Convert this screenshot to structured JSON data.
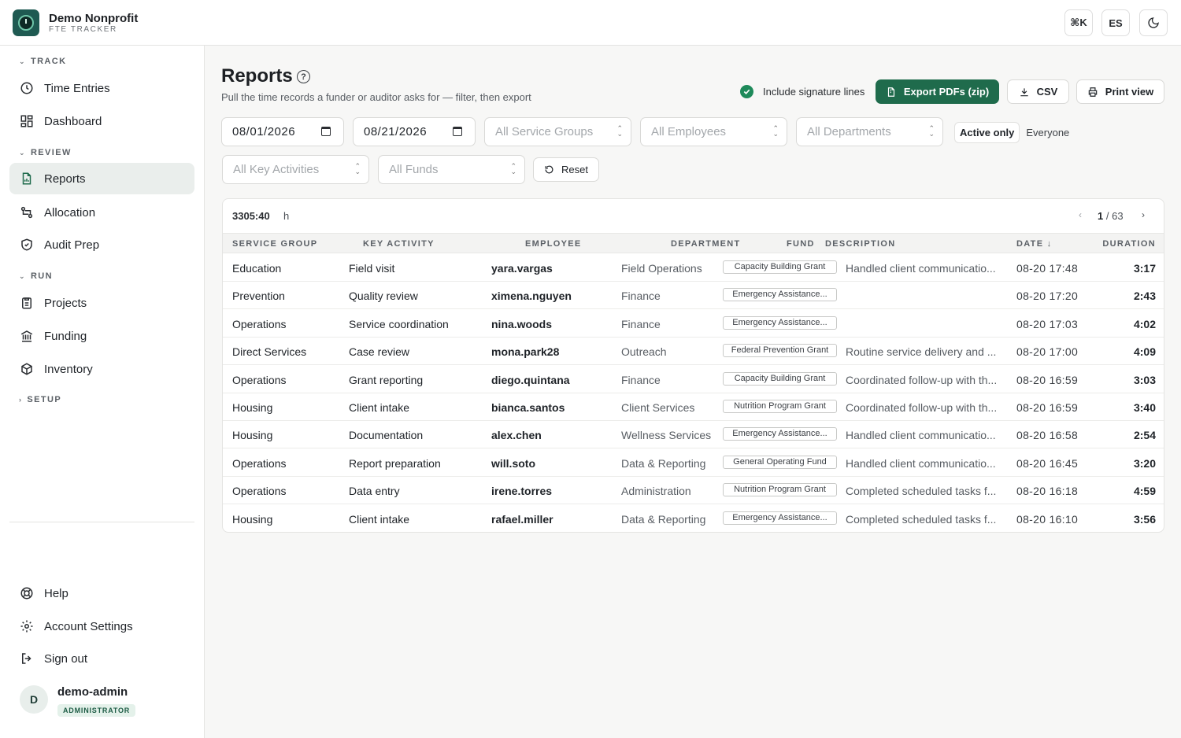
{
  "app": {
    "org_name": "Demo Nonprofit",
    "org_subtitle": "FTE TRACKER",
    "cmdk_label": "⌘K",
    "lang_label": "ES"
  },
  "sidebar": {
    "sections": [
      {
        "title": "TRACK",
        "items": [
          "Time Entries",
          "Dashboard"
        ]
      },
      {
        "title": "REVIEW",
        "items": [
          "Reports",
          "Allocation",
          "Audit Prep"
        ]
      },
      {
        "title": "RUN",
        "items": [
          "Projects",
          "Funding",
          "Inventory"
        ]
      },
      {
        "title": "SETUP",
        "items": []
      }
    ],
    "footer_items": [
      "Help",
      "Account Settings",
      "Sign out"
    ],
    "user": {
      "initial": "D",
      "name": "demo-admin",
      "role": "ADMINISTRATOR"
    }
  },
  "page": {
    "title": "Reports",
    "subtitle": "Pull the time records a funder or auditor asks for — filter, then export",
    "signature_label": "Include signature lines",
    "export_pdfs_label": "Export PDFs (zip)",
    "csv_label": "CSV",
    "print_label": "Print view"
  },
  "filters": {
    "date_from": "08/01/2026",
    "date_to": "08/21/2026",
    "service_groups": "All Service Groups",
    "employees": "All Employees",
    "departments": "All Departments",
    "scope_active": "Active only",
    "scope_everyone": "Everyone",
    "key_activities": "All Key Activities",
    "funds": "All Funds",
    "reset_label": "Reset"
  },
  "table": {
    "total": "3305:40",
    "total_unit": "h",
    "page_current": "1",
    "page_total": "/ 63",
    "columns": [
      "SERVICE GROUP",
      "KEY ACTIVITY",
      "EMPLOYEE",
      "DEPARTMENT",
      "FUND",
      "DESCRIPTION",
      "DATE ↓",
      "DURATION"
    ],
    "rows": [
      [
        "Education",
        "Field visit",
        "yara.vargas",
        "Field Operations",
        "Capacity Building Grant",
        "Handled client communicatio...",
        "08-20 17:48",
        "3:17"
      ],
      [
        "Prevention",
        "Quality review",
        "ximena.nguyen",
        "Finance",
        "Emergency Assistance...",
        "",
        "08-20 17:20",
        "2:43"
      ],
      [
        "Operations",
        "Service coordination",
        "nina.woods",
        "Finance",
        "Emergency Assistance...",
        "",
        "08-20 17:03",
        "4:02"
      ],
      [
        "Direct Services",
        "Case review",
        "mona.park28",
        "Outreach",
        "Federal Prevention Grant",
        "Routine service delivery and ...",
        "08-20 17:00",
        "4:09"
      ],
      [
        "Operations",
        "Grant reporting",
        "diego.quintana",
        "Finance",
        "Capacity Building Grant",
        "Coordinated follow-up with th...",
        "08-20 16:59",
        "3:03"
      ],
      [
        "Housing",
        "Client intake",
        "bianca.santos",
        "Client Services",
        "Nutrition Program Grant",
        "Coordinated follow-up with th...",
        "08-20 16:59",
        "3:40"
      ],
      [
        "Housing",
        "Documentation",
        "alex.chen",
        "Wellness Services",
        "Emergency Assistance...",
        "Handled client communicatio...",
        "08-20 16:58",
        "2:54"
      ],
      [
        "Operations",
        "Report preparation",
        "will.soto",
        "Data & Reporting",
        "General Operating Fund",
        "Handled client communicatio...",
        "08-20 16:45",
        "3:20"
      ],
      [
        "Operations",
        "Data entry",
        "irene.torres",
        "Administration",
        "Nutrition Program Grant",
        "Completed scheduled tasks f...",
        "08-20 16:18",
        "4:59"
      ],
      [
        "Housing",
        "Client intake",
        "rafael.miller",
        "Data & Reporting",
        "Emergency Assistance...",
        "Completed scheduled tasks f...",
        "08-20 16:10",
        "3:56"
      ]
    ]
  }
}
